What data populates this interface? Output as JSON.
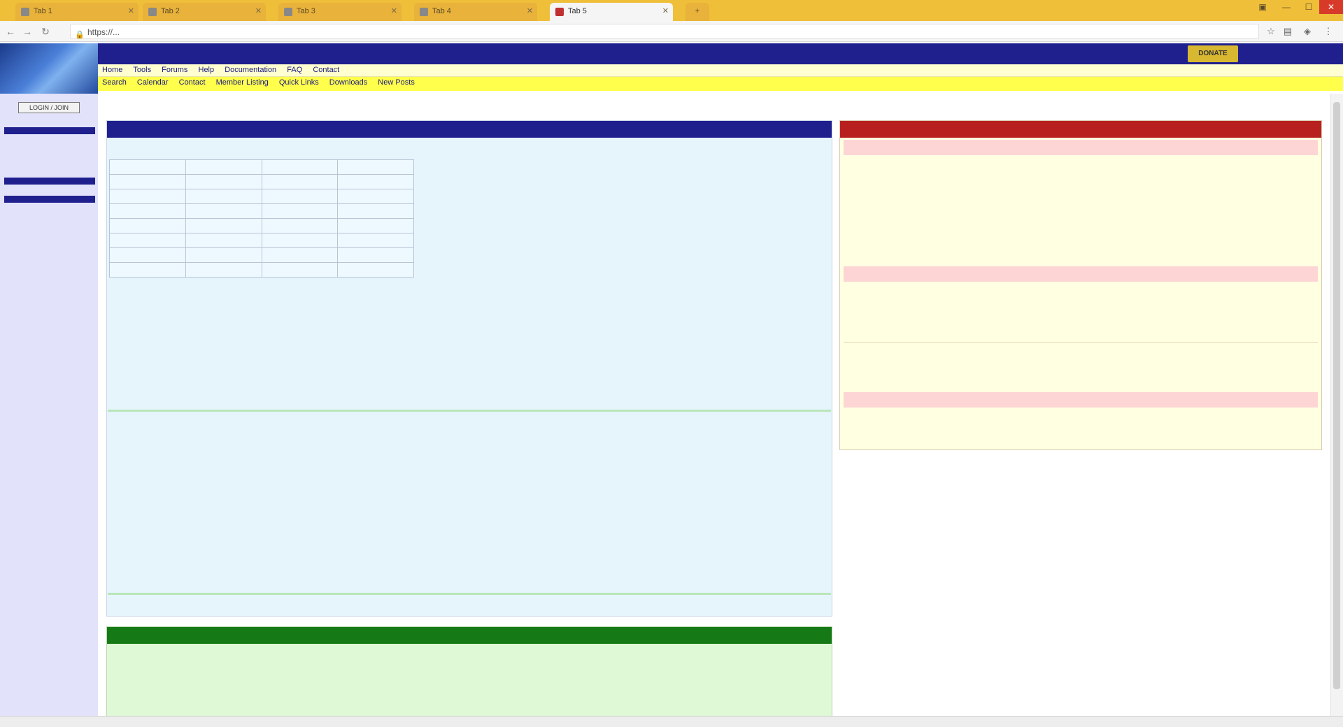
{
  "browser": {
    "tabs": [
      {
        "label": "Tab 1"
      },
      {
        "label": "Tab 2"
      },
      {
        "label": "Tab 3"
      },
      {
        "label": "Tab 4"
      },
      {
        "label": "Tab 5"
      }
    ],
    "new_tab_label": "+",
    "url": "https://..."
  },
  "site": {
    "title": "",
    "subtitle": "",
    "donate_label": "DONATE",
    "menu_row1": [
      "Home",
      "Tools",
      "Forums",
      "Help",
      "Documentation",
      "FAQ",
      "Contact"
    ],
    "menu_row2": [
      "Search",
      "Calendar",
      "Contact",
      "Member Listing",
      "Quick Links",
      "Downloads",
      "New Posts"
    ]
  },
  "sidebar": {
    "login_label": "LOGIN / JOIN",
    "section1": "",
    "links1": [
      "",
      "",
      ""
    ],
    "section2": "",
    "section3": "",
    "links3": [
      "",
      ""
    ]
  },
  "breadcrumb": {
    "home": "",
    "current": "",
    "suffix": ""
  },
  "main": {
    "header": "",
    "table_title": "",
    "table": {
      "headers": [
        "",
        "",
        "",
        ""
      ],
      "rows": [
        [
          "",
          "",
          "",
          ""
        ],
        [
          "",
          "",
          "",
          ""
        ],
        [
          "",
          "",
          "",
          ""
        ],
        [
          "",
          "",
          "",
          ""
        ],
        [
          "",
          "",
          "",
          ""
        ],
        [
          "",
          "",
          "",
          ""
        ],
        [
          "",
          "",
          "",
          ""
        ]
      ]
    },
    "notes_label": "",
    "note1_prefix": "",
    "note1_link": "",
    "note1_suffix": "",
    "note1_sub": "",
    "note2": "",
    "note3": "",
    "note4_prefix": "",
    "note4_link": "",
    "note4_suffix": "",
    "discussion_heading": "",
    "para1": "",
    "para2": "",
    "para3": "",
    "para4": "",
    "more_info_prefix": "",
    "more_info_link": "",
    "footer_note": ""
  },
  "green_panel": {
    "header": "",
    "col1": "",
    "col2": ""
  },
  "right_panel": {
    "header": "",
    "header_left": "",
    "header_right": "",
    "sub1": "",
    "sub2": "",
    "list2": [
      "",
      "",
      "",
      ""
    ],
    "sub3": "",
    "list3": [
      "",
      ""
    ],
    "list3_footer": ""
  },
  "status": {
    "text": "",
    "right": ""
  }
}
